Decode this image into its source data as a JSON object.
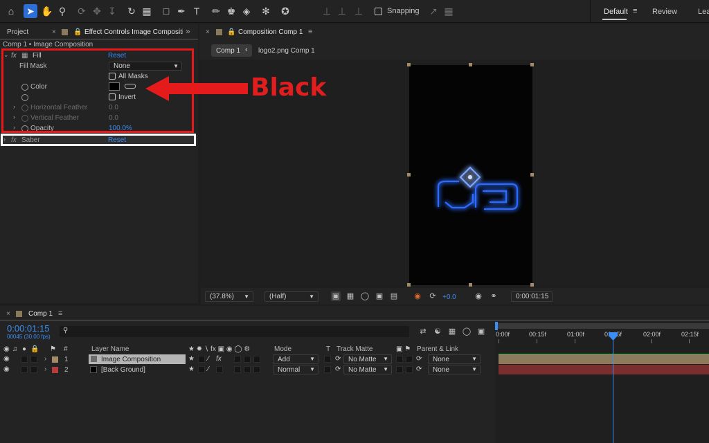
{
  "toolbar": {
    "snapping_label": "Snapping",
    "workspaces": [
      "Default",
      "Review",
      "Lea"
    ],
    "active_workspace": "Default"
  },
  "left_panel": {
    "tabs": [
      {
        "label": "Project"
      },
      {
        "label": "Effect Controls Image Compositio"
      }
    ],
    "layer_path": "Comp 1 • Image Composition",
    "fill_effect": {
      "name": "Fill",
      "reset": "Reset",
      "fill_mask_label": "Fill Mask",
      "fill_mask_value": "None",
      "all_masks_label": "All Masks",
      "color_label": "Color",
      "invert_label": "Invert",
      "horizontal_feather_label": "Horizontal Feather",
      "horizontal_feather_value": "0.0",
      "vertical_feather_label": "Vertical Feather",
      "vertical_feather_value": "0.0",
      "opacity_label": "Opacity",
      "opacity_value": "100.0%"
    },
    "saber_effect": {
      "name": "Saber",
      "reset": "Reset"
    }
  },
  "callout": {
    "text": "Black",
    "color": "#e01e1e"
  },
  "composition_panel": {
    "tab_label": "Composition Comp 1",
    "breadcrumb": [
      "Comp 1",
      "logo2.png Comp 1"
    ],
    "viewer": {
      "zoom": "(37.8%)",
      "resolution": "(Half)",
      "exposure": "+0.0",
      "timecode": "0:00:01:15"
    }
  },
  "timeline": {
    "tab_label": "Comp 1",
    "timecode": "0:00:01:15",
    "frames_fps": "00045 (30.00 fps)",
    "search_icon": "search-icon",
    "columns": {
      "num": "#",
      "layer_name": "Layer Name",
      "mode": "Mode",
      "t": "T",
      "track_matte": "Track Matte",
      "parent_link": "Parent & Link"
    },
    "layers": [
      {
        "num": "1",
        "name": "Image Composition",
        "mode": "Add",
        "track_matte": "No Matte",
        "parent": "None",
        "label_color": "#a38b68",
        "bar_color": "#8b7a5c"
      },
      {
        "num": "2",
        "name": "[Back Ground]",
        "mode": "Normal",
        "track_matte": "No Matte",
        "parent": "None",
        "label_color": "#b83c3c",
        "bar_color": "#7a2e2e"
      }
    ],
    "ruler_labels": [
      "0:00f",
      "00:15f",
      "01:00f",
      "01:15f",
      "02:00f",
      "02:15f"
    ],
    "playhead_color": "#3b8ef5"
  }
}
